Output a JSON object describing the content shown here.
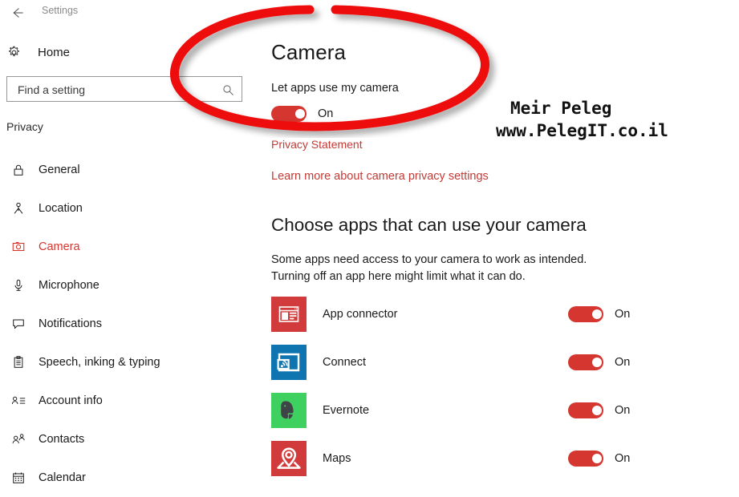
{
  "window": {
    "app_title": "Settings",
    "back_icon": "back-arrow-icon"
  },
  "sidebar": {
    "home": {
      "label": "Home",
      "icon": "gear-icon"
    },
    "search": {
      "placeholder": "Find a setting",
      "value": "",
      "icon": "search-icon"
    },
    "group_label": "Privacy",
    "items": [
      {
        "label": "General",
        "icon": "lock-icon",
        "selected": false
      },
      {
        "label": "Location",
        "icon": "location-pin-icon",
        "selected": false
      },
      {
        "label": "Camera",
        "icon": "camera-icon",
        "selected": true
      },
      {
        "label": "Microphone",
        "icon": "microphone-icon",
        "selected": false
      },
      {
        "label": "Notifications",
        "icon": "speech-bubble-icon",
        "selected": false
      },
      {
        "label": "Speech, inking & typing",
        "icon": "clipboard-icon",
        "selected": false
      },
      {
        "label": "Account info",
        "icon": "account-list-icon",
        "selected": false
      },
      {
        "label": "Contacts",
        "icon": "contacts-icon",
        "selected": false
      },
      {
        "label": "Calendar",
        "icon": "calendar-icon",
        "selected": false
      }
    ]
  },
  "main": {
    "page_title": "Camera",
    "master_toggle": {
      "label": "Let apps use my camera",
      "state_label": "On",
      "on": true
    },
    "privacy_statement_link": "Privacy Statement",
    "learn_more_link": "Learn more about camera privacy settings",
    "section_heading": "Choose apps that can use your camera",
    "section_description": "Some apps need access to your camera to work as intended. Turning off an app here might limit what it can do.",
    "apps": [
      {
        "name": "App connector",
        "icon": "app-connector-icon",
        "state_label": "On",
        "on": true,
        "icon_bg": "#d13b3b"
      },
      {
        "name": "Connect",
        "icon": "connect-cast-icon",
        "state_label": "On",
        "on": true,
        "icon_bg": "#0f75b0"
      },
      {
        "name": "Evernote",
        "icon": "evernote-elephant-icon",
        "state_label": "On",
        "on": true,
        "icon_bg": "#3fd15f"
      },
      {
        "name": "Maps",
        "icon": "map-pin-icon",
        "state_label": "On",
        "on": true,
        "icon_bg": "#d13b3b"
      }
    ]
  },
  "annotation": {
    "shape": "red-ellipse-highlight",
    "color": "#ee1111"
  },
  "watermark": {
    "line1": "Meir Peleg",
    "line2": "www.PelegIT.co.il"
  },
  "colors": {
    "accent_red": "#d5362f",
    "link_red": "#c43a36",
    "annotation_red": "#ee1111",
    "text": "#1a1a1a",
    "muted_text": "#8a8a8a"
  }
}
